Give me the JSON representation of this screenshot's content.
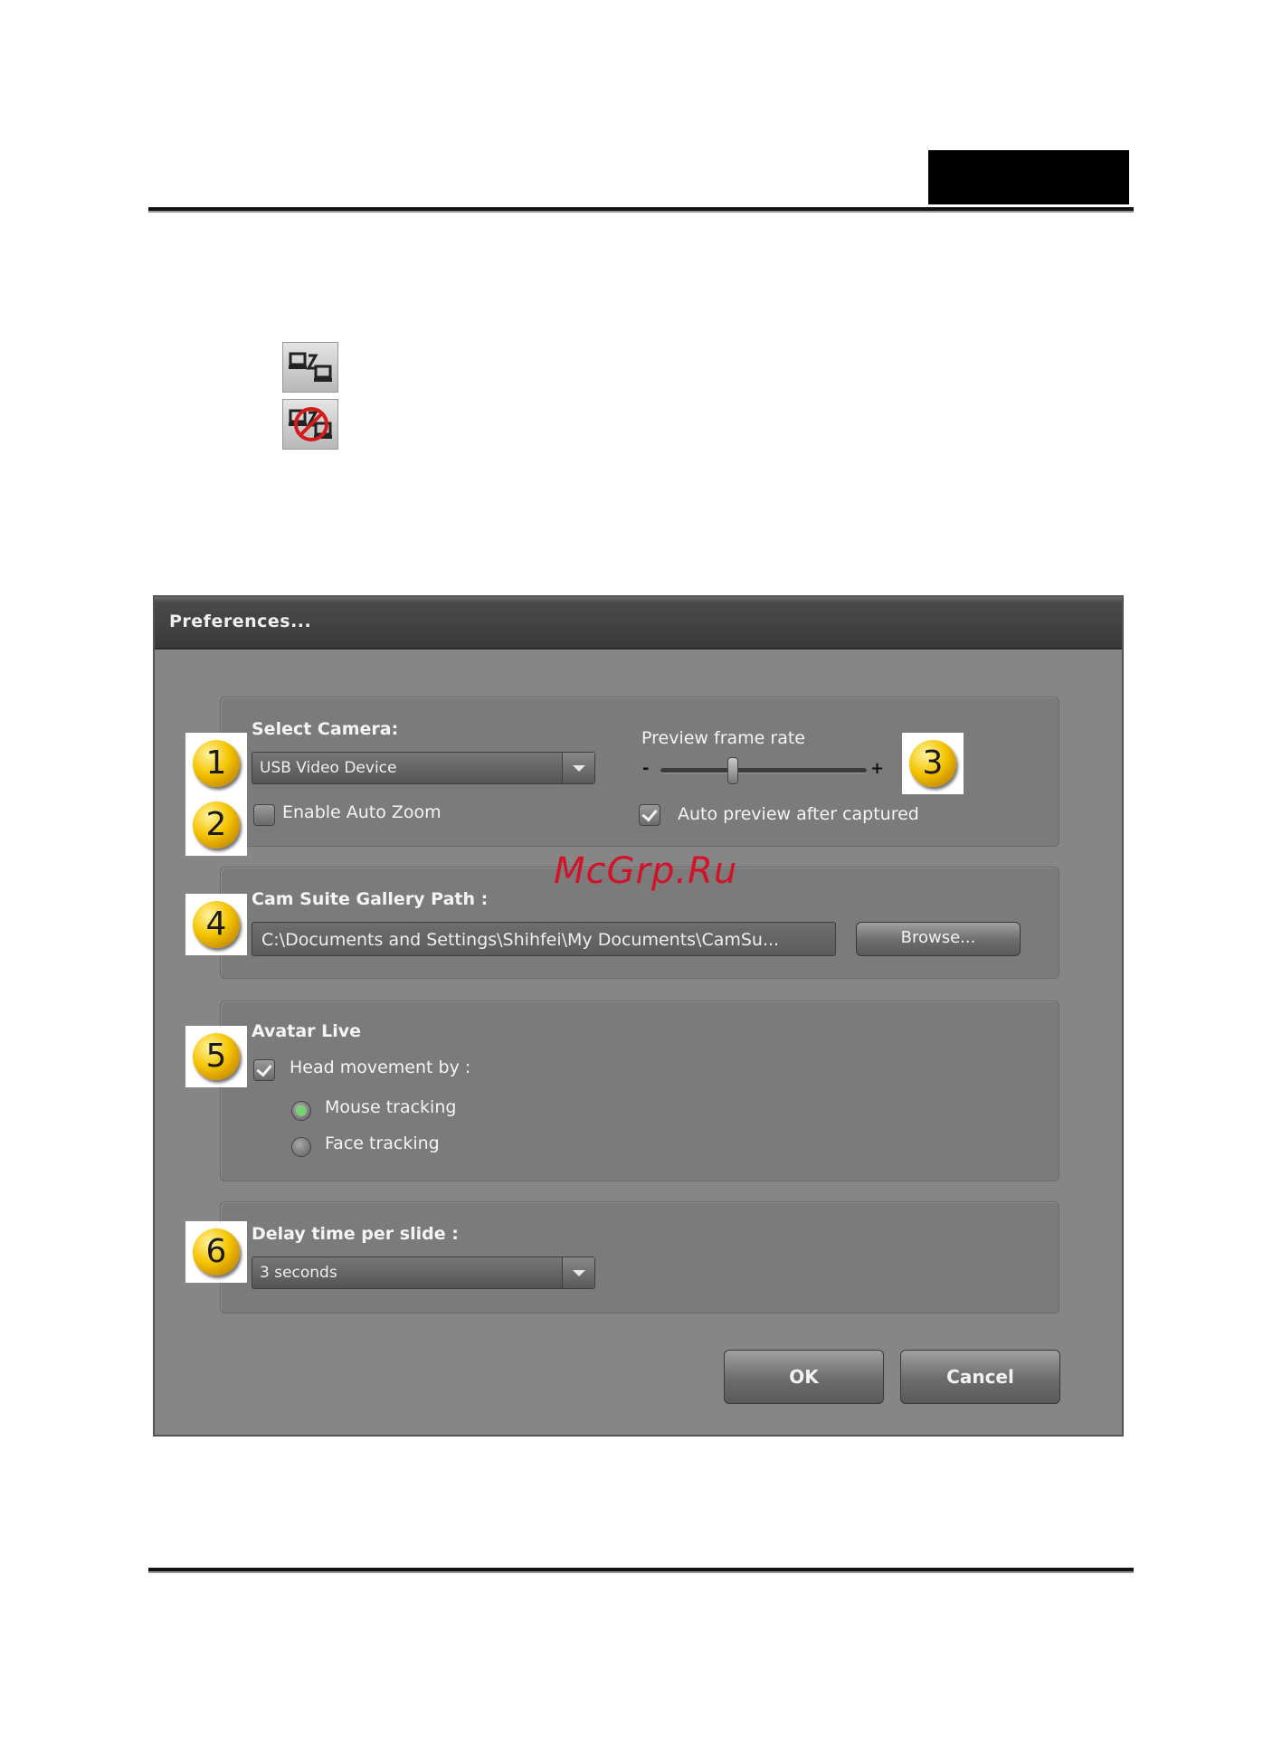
{
  "doc": {
    "watermark": "McGrp.Ru"
  },
  "icons": [
    {
      "name": "connect-icon"
    },
    {
      "name": "disconnect-icon"
    }
  ],
  "dialog": {
    "title": "Preferences...",
    "camera": {
      "label": "Select Camera:",
      "selected": "USB Video Device"
    },
    "auto_zoom": {
      "label": "Enable Auto Zoom",
      "checked": false
    },
    "frame_rate": {
      "label": "Preview frame rate",
      "minus": "-",
      "plus": "+",
      "level": 0.35
    },
    "auto_preview": {
      "label": "Auto preview after captured",
      "checked": true
    },
    "gallery": {
      "label": "Cam Suite Gallery Path :",
      "path": "C:\\Documents and Settings\\Shihfei\\My Documents\\CamSu...",
      "browse_label": "Browse..."
    },
    "avatar": {
      "label": "Avatar Live",
      "head_movement_label": "Head movement by :",
      "head_movement_checked": true,
      "options": [
        {
          "label": "Mouse tracking",
          "selected": true
        },
        {
          "label": "Face tracking",
          "selected": false
        }
      ]
    },
    "delay": {
      "label": "Delay time per slide :",
      "selected": "3 seconds"
    },
    "ok_label": "OK",
    "cancel_label": "Cancel"
  },
  "badges": [
    "1",
    "2",
    "3",
    "4",
    "5",
    "6"
  ],
  "colors": {
    "dialog_bg": "#868686",
    "titlebar": "#3a3a3a",
    "badge": "#f4c400",
    "radio_on": "#6dd66d"
  }
}
